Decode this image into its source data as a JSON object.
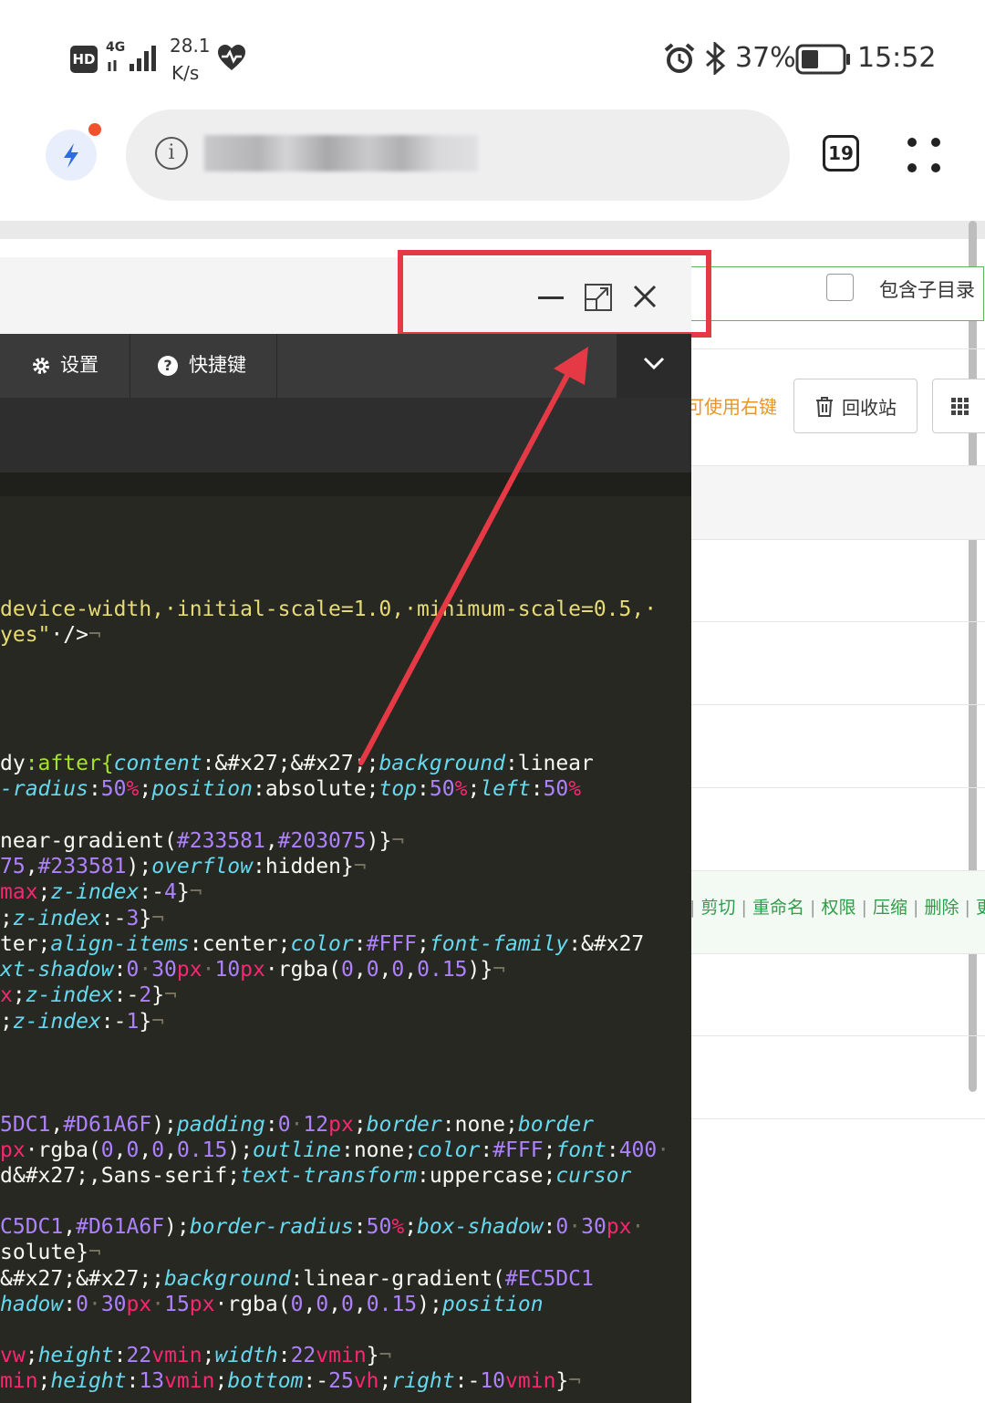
{
  "status": {
    "hd": "HD",
    "net_type": "4G",
    "speed_value": "28.1",
    "speed_unit": "K/s",
    "battery": "37%",
    "time": "15:52"
  },
  "browser": {
    "tab_count": "19"
  },
  "editor": {
    "settings_label": "设置",
    "shortcuts_label": "快捷键",
    "code_lines": [
      [
        [
          "device-width,·initial-scale=1.0,·minimum-scale=0.5,·",
          "c-y"
        ]
      ],
      [
        [
          "yes\"",
          "c-y"
        ],
        [
          "·/>",
          "c-w"
        ],
        [
          "¬",
          "c-d"
        ]
      ],
      [
        [
          "dy",
          "c-w"
        ],
        [
          ":after{",
          "c-g"
        ],
        [
          "content",
          "c-c"
        ],
        [
          ":&#x27;&#x27;;",
          "c-w"
        ],
        [
          "background",
          "c-c"
        ],
        [
          ":linear",
          "c-w"
        ]
      ],
      [
        [
          "-radius",
          "c-c"
        ],
        [
          ":",
          "c-w"
        ],
        [
          "50",
          "c-n"
        ],
        [
          "%",
          "c-p"
        ],
        [
          ";",
          "c-w"
        ],
        [
          "position",
          "c-c"
        ],
        [
          ":absolute;",
          "c-w"
        ],
        [
          "top",
          "c-c"
        ],
        [
          ":",
          "c-w"
        ],
        [
          "50",
          "c-n"
        ],
        [
          "%",
          "c-p"
        ],
        [
          ";",
          "c-w"
        ],
        [
          "left",
          "c-c"
        ],
        [
          ":",
          "c-w"
        ],
        [
          "50",
          "c-n"
        ],
        [
          "%",
          "c-p"
        ]
      ],
      [
        [
          "near-gradient(",
          "c-w"
        ],
        [
          "#233581",
          "c-n"
        ],
        [
          ",",
          "c-w"
        ],
        [
          "#203075",
          "c-n"
        ],
        [
          ")}",
          "c-w"
        ],
        [
          "¬",
          "c-d"
        ]
      ],
      [
        [
          "75",
          "c-n"
        ],
        [
          ",",
          "c-w"
        ],
        [
          "#233581",
          "c-n"
        ],
        [
          ");",
          "c-w"
        ],
        [
          "overflow",
          "c-c"
        ],
        [
          ":hidden}",
          "c-w"
        ],
        [
          "¬",
          "c-d"
        ]
      ],
      [
        [
          "max",
          "c-p"
        ],
        [
          ";",
          "c-w"
        ],
        [
          "z-index",
          "c-c"
        ],
        [
          ":-",
          "c-w"
        ],
        [
          "4",
          "c-n"
        ],
        [
          "}",
          "c-w"
        ],
        [
          "¬",
          "c-d"
        ]
      ],
      [
        [
          ";",
          "c-w"
        ],
        [
          "z-index",
          "c-c"
        ],
        [
          ":-",
          "c-w"
        ],
        [
          "3",
          "c-n"
        ],
        [
          "}",
          "c-w"
        ],
        [
          "¬",
          "c-d"
        ]
      ],
      [
        [
          "ter;",
          "c-w"
        ],
        [
          "align-items",
          "c-c"
        ],
        [
          ":center;",
          "c-w"
        ],
        [
          "color",
          "c-c"
        ],
        [
          ":",
          "c-w"
        ],
        [
          "#FFF",
          "c-n"
        ],
        [
          ";",
          "c-w"
        ],
        [
          "font-family",
          "c-c"
        ],
        [
          ":&#x27",
          "c-w"
        ]
      ],
      [
        [
          "xt-shadow",
          "c-c"
        ],
        [
          ":",
          "c-w"
        ],
        [
          "0",
          "c-n"
        ],
        [
          "·",
          "c-d"
        ],
        [
          "30",
          "c-n"
        ],
        [
          "px",
          "c-p"
        ],
        [
          "·",
          "c-d"
        ],
        [
          "10",
          "c-n"
        ],
        [
          "px",
          "c-p"
        ],
        [
          "·rgba(",
          "c-w"
        ],
        [
          "0",
          "c-n"
        ],
        [
          ",",
          "c-w"
        ],
        [
          "0",
          "c-n"
        ],
        [
          ",",
          "c-w"
        ],
        [
          "0",
          "c-n"
        ],
        [
          ",",
          "c-w"
        ],
        [
          "0.15",
          "c-n"
        ],
        [
          ")}",
          "c-w"
        ],
        [
          "¬",
          "c-d"
        ]
      ],
      [
        [
          "x",
          "c-p"
        ],
        [
          ";",
          "c-w"
        ],
        [
          "z-index",
          "c-c"
        ],
        [
          ":-",
          "c-w"
        ],
        [
          "2",
          "c-n"
        ],
        [
          "}",
          "c-w"
        ],
        [
          "¬",
          "c-d"
        ]
      ],
      [
        [
          ";",
          "c-w"
        ],
        [
          "z-index",
          "c-c"
        ],
        [
          ":-",
          "c-w"
        ],
        [
          "1",
          "c-n"
        ],
        [
          "}",
          "c-w"
        ],
        [
          "¬",
          "c-d"
        ]
      ],
      [
        [
          "5DC1",
          "c-n"
        ],
        [
          ",",
          "c-w"
        ],
        [
          "#D61A6F",
          "c-n"
        ],
        [
          ");",
          "c-w"
        ],
        [
          "padding",
          "c-c"
        ],
        [
          ":",
          "c-w"
        ],
        [
          "0",
          "c-n"
        ],
        [
          "·",
          "c-d"
        ],
        [
          "12",
          "c-n"
        ],
        [
          "px",
          "c-p"
        ],
        [
          ";",
          "c-w"
        ],
        [
          "border",
          "c-c"
        ],
        [
          ":none;",
          "c-w"
        ],
        [
          "border",
          "c-c"
        ]
      ],
      [
        [
          "px",
          "c-p"
        ],
        [
          "·rgba(",
          "c-w"
        ],
        [
          "0",
          "c-n"
        ],
        [
          ",",
          "c-w"
        ],
        [
          "0",
          "c-n"
        ],
        [
          ",",
          "c-w"
        ],
        [
          "0",
          "c-n"
        ],
        [
          ",",
          "c-w"
        ],
        [
          "0.15",
          "c-n"
        ],
        [
          ");",
          "c-w"
        ],
        [
          "outline",
          "c-c"
        ],
        [
          ":none;",
          "c-w"
        ],
        [
          "color",
          "c-c"
        ],
        [
          ":",
          "c-w"
        ],
        [
          "#FFF",
          "c-n"
        ],
        [
          ";",
          "c-w"
        ],
        [
          "font",
          "c-c"
        ],
        [
          ":",
          "c-w"
        ],
        [
          "400",
          "c-n"
        ],
        [
          "·",
          "c-d"
        ]
      ],
      [
        [
          "d&#x27;,Sans-serif;",
          "c-w"
        ],
        [
          "text-transform",
          "c-c"
        ],
        [
          ":uppercase;",
          "c-w"
        ],
        [
          "cursor",
          "c-c"
        ]
      ],
      [
        [
          "C5DC1",
          "c-n"
        ],
        [
          ",",
          "c-w"
        ],
        [
          "#D61A6F",
          "c-n"
        ],
        [
          ");",
          "c-w"
        ],
        [
          "border-radius",
          "c-c"
        ],
        [
          ":",
          "c-w"
        ],
        [
          "50",
          "c-n"
        ],
        [
          "%",
          "c-p"
        ],
        [
          ";",
          "c-w"
        ],
        [
          "box-shadow",
          "c-c"
        ],
        [
          ":",
          "c-w"
        ],
        [
          "0",
          "c-n"
        ],
        [
          "·",
          "c-d"
        ],
        [
          "30",
          "c-n"
        ],
        [
          "px",
          "c-p"
        ],
        [
          "·",
          "c-d"
        ]
      ],
      [
        [
          "solute}",
          "c-w"
        ],
        [
          "¬",
          "c-d"
        ]
      ],
      [
        [
          "&#x27;&#x27;;",
          "c-w"
        ],
        [
          "background",
          "c-c"
        ],
        [
          ":linear-gradient(",
          "c-w"
        ],
        [
          "#EC5DC1",
          "c-n"
        ]
      ],
      [
        [
          "hadow",
          "c-c"
        ],
        [
          ":",
          "c-w"
        ],
        [
          "0",
          "c-n"
        ],
        [
          "·",
          "c-d"
        ],
        [
          "30",
          "c-n"
        ],
        [
          "px",
          "c-p"
        ],
        [
          "·",
          "c-d"
        ],
        [
          "15",
          "c-n"
        ],
        [
          "px",
          "c-p"
        ],
        [
          "·rgba(",
          "c-w"
        ],
        [
          "0",
          "c-n"
        ],
        [
          ",",
          "c-w"
        ],
        [
          "0",
          "c-n"
        ],
        [
          ",",
          "c-w"
        ],
        [
          "0",
          "c-n"
        ],
        [
          ",",
          "c-w"
        ],
        [
          "0.15",
          "c-n"
        ],
        [
          ");",
          "c-w"
        ],
        [
          "position",
          "c-c"
        ]
      ],
      [
        [
          "vw",
          "c-p"
        ],
        [
          ";",
          "c-w"
        ],
        [
          "height",
          "c-c"
        ],
        [
          ":",
          "c-w"
        ],
        [
          "22",
          "c-n"
        ],
        [
          "vmin",
          "c-p"
        ],
        [
          ";",
          "c-w"
        ],
        [
          "width",
          "c-c"
        ],
        [
          ":",
          "c-w"
        ],
        [
          "22",
          "c-n"
        ],
        [
          "vmin",
          "c-p"
        ],
        [
          "}",
          "c-w"
        ],
        [
          "¬",
          "c-d"
        ]
      ],
      [
        [
          "min",
          "c-p"
        ],
        [
          ";",
          "c-w"
        ],
        [
          "height",
          "c-c"
        ],
        [
          ":",
          "c-w"
        ],
        [
          "13",
          "c-n"
        ],
        [
          "vmin",
          "c-p"
        ],
        [
          ";",
          "c-w"
        ],
        [
          "bottom",
          "c-c"
        ],
        [
          ":-",
          "c-w"
        ],
        [
          "25",
          "c-n"
        ],
        [
          "vh",
          "c-p"
        ],
        [
          ";",
          "c-w"
        ],
        [
          "right",
          "c-c"
        ],
        [
          ":-",
          "c-w"
        ],
        [
          "10",
          "c-n"
        ],
        [
          "vmin",
          "c-p"
        ],
        [
          "}",
          "c-w"
        ],
        [
          "¬",
          "c-d"
        ]
      ]
    ]
  },
  "file_manager": {
    "include_subdir_label": "包含子目录",
    "right_click_hint": "可使用右键",
    "recycle_bin_label": "回收站",
    "actions": [
      "剪切",
      "重命名",
      "权限",
      "压缩",
      "删除",
      "更"
    ]
  }
}
